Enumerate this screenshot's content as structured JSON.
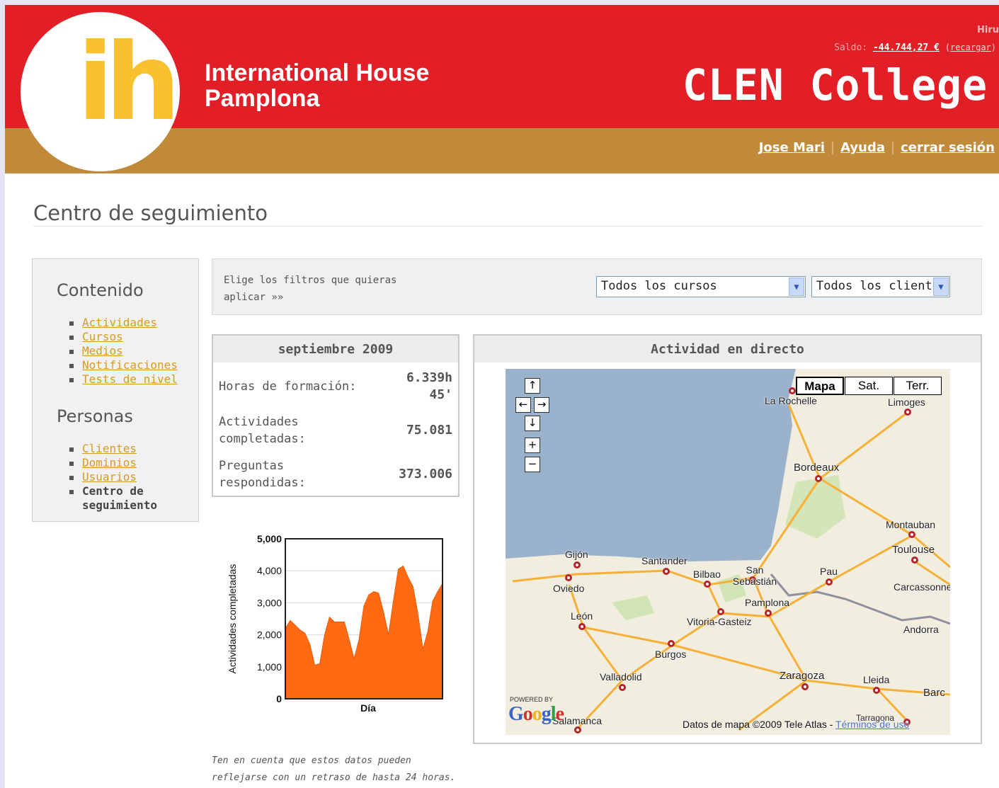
{
  "header": {
    "logo_text": "ih",
    "org_line1": "International House",
    "org_line2": "Pamplona",
    "hiru": "Hiru",
    "saldo_label": "Saldo:",
    "saldo_amount": "-44.744,27 €",
    "recargar": "recargar",
    "brand": "CLEN College",
    "user_link": "Jose Mari",
    "help_link": "Ayuda",
    "logout_link": "cerrar sesión"
  },
  "page": {
    "title": "Centro de seguimiento"
  },
  "sidebar": {
    "heading_content": "Contenido",
    "content_items": [
      {
        "label": "Actividades"
      },
      {
        "label": "Cursos"
      },
      {
        "label": "Medios"
      },
      {
        "label": "Notificaciones"
      },
      {
        "label": "Tests de nivel"
      }
    ],
    "heading_people": "Personas",
    "people_items": [
      {
        "label": "Clientes"
      },
      {
        "label": "Dominios"
      },
      {
        "label": "Usuarios"
      },
      {
        "label": "Centro de seguimiento",
        "current": true
      }
    ]
  },
  "filters": {
    "label": "Elige los filtros que quieras aplicar »»",
    "course_select": "Todos los cursos",
    "client_select": "Todos los clientes"
  },
  "stats": {
    "heading": "septiembre 2009",
    "hours_label": "Horas de formación:",
    "hours_value_1": "6.339h",
    "hours_value_2": "45'",
    "activities_label_1": "Actividades",
    "activities_label_2": "completadas:",
    "activities_value": "75.081",
    "questions_label_1": "Preguntas",
    "questions_label_2": "respondidas:",
    "questions_value": "373.006"
  },
  "chart_data": {
    "type": "area",
    "xlabel": "Día",
    "ylabel": "Actividades completadas",
    "ylim": [
      0,
      5000
    ],
    "yticks": [
      "0",
      "1,000",
      "2,000",
      "3,000",
      "4,000",
      "5,000"
    ],
    "color": "#ff6a13",
    "grid": true,
    "values": [
      2200,
      2450,
      2300,
      2150,
      2050,
      1700,
      1050,
      1100,
      2000,
      2550,
      2400,
      2400,
      2400,
      1850,
      1250,
      1850,
      2900,
      3250,
      3350,
      3300,
      2700,
      2000,
      3050,
      4050,
      4150,
      3800,
      3500,
      2650,
      1550,
      2100,
      3050,
      3350,
      3600
    ]
  },
  "note": {
    "line1": "Ten en cuenta que estos datos pueden",
    "line2": "reflejarse con un retraso de hasta 24 horas."
  },
  "map": {
    "heading": "Actividad en directo",
    "type_buttons": [
      "Mapa",
      "Sat.",
      "Terr."
    ],
    "cities": [
      "La Rochelle",
      "Limoges",
      "Bordeaux",
      "Montauban",
      "Toulouse",
      "Gijón",
      "Santander",
      "San Sebastián",
      "Bilbao",
      "Oviedo",
      "Pau",
      "Carcassonne",
      "Pamplona",
      "León",
      "Vitoria-Gasteiz",
      "Andorra",
      "Burgos",
      "Valladolid",
      "Zaragoza",
      "Lleida",
      "Barc",
      "Salamanca",
      "Tarragona"
    ],
    "powered": "POWERED BY",
    "google": "Google",
    "attribution": "Datos de mapa ©2009 Tele Atlas - ",
    "terms": "Términos de uso",
    "colors": {
      "sea": "#9ab2cc",
      "land": "#f1eee0",
      "roads": "#f6b037",
      "pins": "#b4242a"
    }
  }
}
